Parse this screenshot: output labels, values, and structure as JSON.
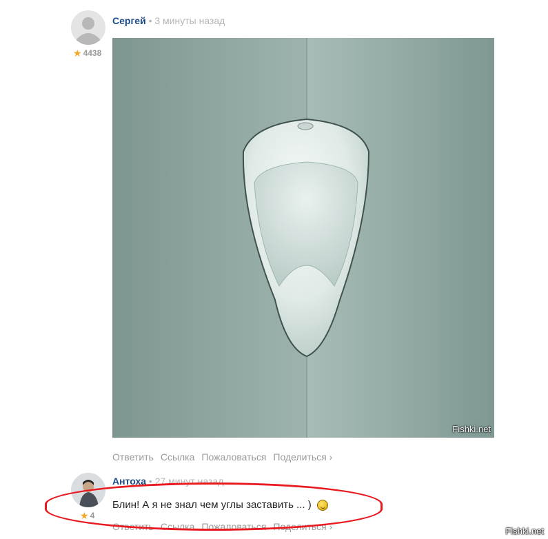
{
  "comments": [
    {
      "author": "Сергей",
      "time": "• 3 минуты назад",
      "rating": "4438",
      "image_watermark": "Fishki.net",
      "actions": [
        "Ответить",
        "Ссылка",
        "Пожаловаться",
        "Поделиться ›"
      ]
    },
    {
      "author": "Антоха",
      "time": "• 27 минут назад",
      "rating": "4",
      "text": "Блин! А я не знал чем углы заставить ... )",
      "actions": [
        "Ответить",
        "Ссылка",
        "Пожаловаться",
        "Поделиться ›"
      ]
    }
  ],
  "site_watermark": "Fishki.net",
  "colors": {
    "author": "#1b4a86",
    "muted": "#9a9a9a",
    "star": "#f5a623",
    "highlight": "#e8191f"
  }
}
